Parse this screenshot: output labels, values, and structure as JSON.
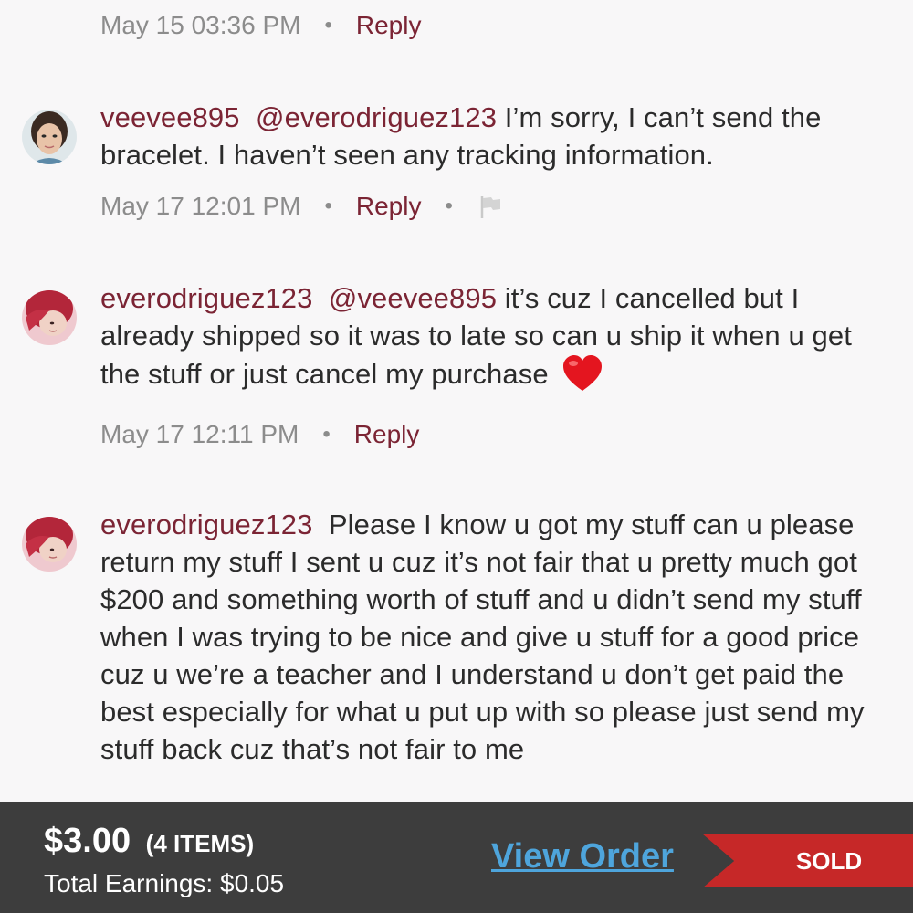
{
  "comments": [
    {
      "timestamp": "May 15 03:36 PM",
      "reply_label": "Reply"
    },
    {
      "username": "veevee895",
      "mention": "@everodriguez123",
      "text": " I’m sorry, I can’t send the bracelet. I haven’t seen any tracking information.",
      "timestamp": "May 17 12:01 PM",
      "reply_label": "Reply",
      "flag_icon": "flag-icon"
    },
    {
      "username": "everodriguez123",
      "mention": "@veevee895",
      "text": " it’s cuz I cancelled but I already shipped so it was to late so can u ship it when u get the stuff or just cancel my purchase",
      "emoji": "heart-icon",
      "timestamp": "May 17 12:11 PM",
      "reply_label": "Reply"
    },
    {
      "username": "everodriguez123",
      "text": "Please I know u got my stuff can u please return my stuff I sent u  cuz it’s not fair that u pretty much got $200 and something worth of stuff and u didn’t send my stuff when I was trying to be nice and give u stuff for a good price cuz u we’re a teacher and I understand u don’t get paid the best especially for what u put up with so please just send my stuff back cuz that’s not fair to me"
    }
  ],
  "order_bar": {
    "price": "$3.00",
    "items": "(4 ITEMS)",
    "earnings": "Total Earnings: $0.05",
    "view_order_label": "View Order",
    "status": "SOLD"
  },
  "colors": {
    "username": "#7b2434",
    "bar_bg": "#3d3d3d",
    "link": "#4ea5dc",
    "ribbon": "#c62828"
  }
}
